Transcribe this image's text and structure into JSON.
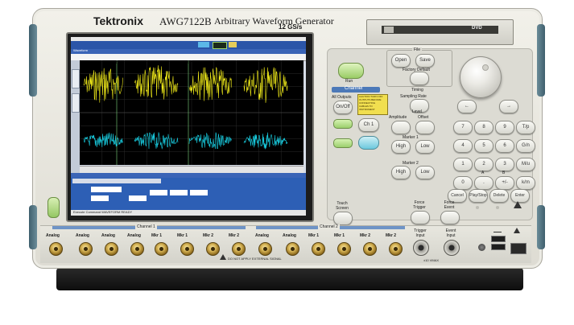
{
  "brand": "Tektronix",
  "model": "AWG7122B",
  "product": "Arbitrary Waveform Generator",
  "rate": "12 GS/s",
  "dvd_label": "DVD",
  "menu": {
    "open": "Open",
    "save": "Save",
    "file": "File",
    "factory_default": "Factory Default",
    "timing": "Timing",
    "sampling_rate": "Sampling Rate"
  },
  "channel_panel": {
    "title": "Channel",
    "all_outputs": "All Outputs",
    "on_off": "On/Off",
    "ch1": "Ch 1",
    "caution": "CAUTION TURN OFF OUTPUTS BEFORE CONNECTING CABLES TO INSTRUMENT",
    "amplitude": "Amplitude",
    "offset": "Offset",
    "level": "Level",
    "marker1": "Marker 1",
    "marker2": "Marker 2",
    "high": "High",
    "low": "Low"
  },
  "keypad": [
    "7",
    "8",
    "9",
    "T/p",
    "4",
    "5",
    "6",
    "G/n",
    "1",
    "2",
    "3",
    "M/u",
    "0",
    ".",
    "+/-",
    "k/m"
  ],
  "keypad_sub": [
    "",
    "",
    "",
    "",
    "",
    "",
    "",
    "",
    "",
    "",
    "",
    "",
    "",
    "A",
    "B",
    ""
  ],
  "bottom_keys": [
    "Cancel",
    "Play/Stop",
    "Delete",
    "Enter"
  ],
  "touch_screen": "Touch Screen",
  "force_trigger": "Force Trigger",
  "force_event": "Force Event",
  "run": "Run",
  "channel1": "Channel 1",
  "channel2": "Channel 2",
  "connectors": [
    "Analog",
    "Analog",
    "Analog",
    "Analog",
    "Mkr 1",
    "Mkr 1",
    "Mkr 2",
    "Mkr 2",
    "Analog",
    "Analog",
    "Mkr 1",
    "Mkr 1",
    "Mkr 2",
    "Mkr 2"
  ],
  "trigger_input": "Trigger Input",
  "event_input": "Event Input",
  "do_not_apply": "DO NOT APPLY EXTERNAL SIGNAL",
  "volt_limit": "±10 VMAX",
  "screen": {
    "title": "Waveform",
    "markers": [
      "B",
      "C"
    ],
    "footer": "Execute Command  WAVEFORM  READY"
  },
  "colors": {
    "ch1": "#f2ec1a",
    "ch2": "#19d2e6",
    "chassis": "#e7e6de",
    "panel": "#d9d8d0"
  }
}
